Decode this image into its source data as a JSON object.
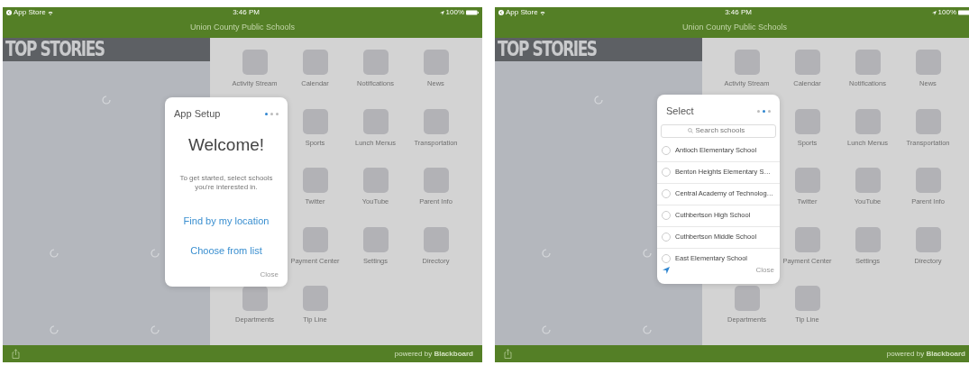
{
  "screens": [
    {
      "status_bar": {
        "back_label": "App Store",
        "time": "3:46 PM",
        "battery": "100%"
      },
      "header": {
        "title": "Union County Public Schools"
      },
      "sidebar": {
        "heading": "TOP STORIES"
      },
      "grid_rows": [
        {
          "tiles": [
            "Activity Stream",
            "Calendar",
            "Notifications",
            "News"
          ]
        },
        {
          "tiles": [
            "Sports",
            "Lunch Menus",
            "Transportation"
          ]
        },
        {
          "tiles": [
            "Twitter",
            "YouTube",
            "Parent Info"
          ]
        },
        {
          "tiles": [
            "Payment Center",
            "Settings",
            "Directory"
          ]
        },
        {
          "tiles": [
            "Departments",
            "Tip Line"
          ]
        }
      ],
      "footer": {
        "branding": "powered by **Blackboard**"
      },
      "dialog": {
        "kind": "welcome",
        "title": "App Setup",
        "steps": [
          {
            "selected": true
          },
          {
            "selected": false
          },
          {
            "selected": false
          }
        ],
        "heading": "Welcome!",
        "message": "To get started, select schools you're interested in.",
        "actions": [
          "Find by my location",
          "Choose from list"
        ],
        "close": "Close"
      }
    },
    {
      "status_bar": {
        "back_label": "App Store",
        "time": "3:46 PM",
        "battery": "100%"
      },
      "header": {
        "title": "Union County Public Schools"
      },
      "sidebar": {
        "heading": "TOP STORIES"
      },
      "grid_rows": [
        {
          "tiles": [
            "Activity Stream",
            "Calendar",
            "Notifications",
            "News"
          ]
        },
        {
          "tiles": [
            "Sports",
            "Lunch Menus",
            "Transportation"
          ]
        },
        {
          "tiles": [
            "Twitter",
            "YouTube",
            "Parent Info"
          ]
        },
        {
          "tiles": [
            "Payment Center",
            "Settings",
            "Directory"
          ]
        },
        {
          "tiles": [
            "Departments",
            "Tip Line"
          ]
        }
      ],
      "footer": {
        "branding": "powered by **Blackboard**"
      },
      "dialog": {
        "kind": "select",
        "title": "Select",
        "steps": [
          {
            "selected": false
          },
          {
            "selected": true
          },
          {
            "selected": false
          }
        ],
        "search_placeholder": "Search schools",
        "schools": [
          {
            "name": "Antioch Elementary School",
            "selected": false
          },
          {
            "name": "Benton Heights Elementary S…",
            "selected": false
          },
          {
            "name": "Central Academy of Technolog…",
            "selected": false
          },
          {
            "name": "Cuthbertson High School",
            "selected": false
          },
          {
            "name": "Cuthbertson Middle School",
            "selected": false
          },
          {
            "name": "East Elementary School",
            "selected": false
          }
        ],
        "close": "Close"
      }
    }
  ]
}
